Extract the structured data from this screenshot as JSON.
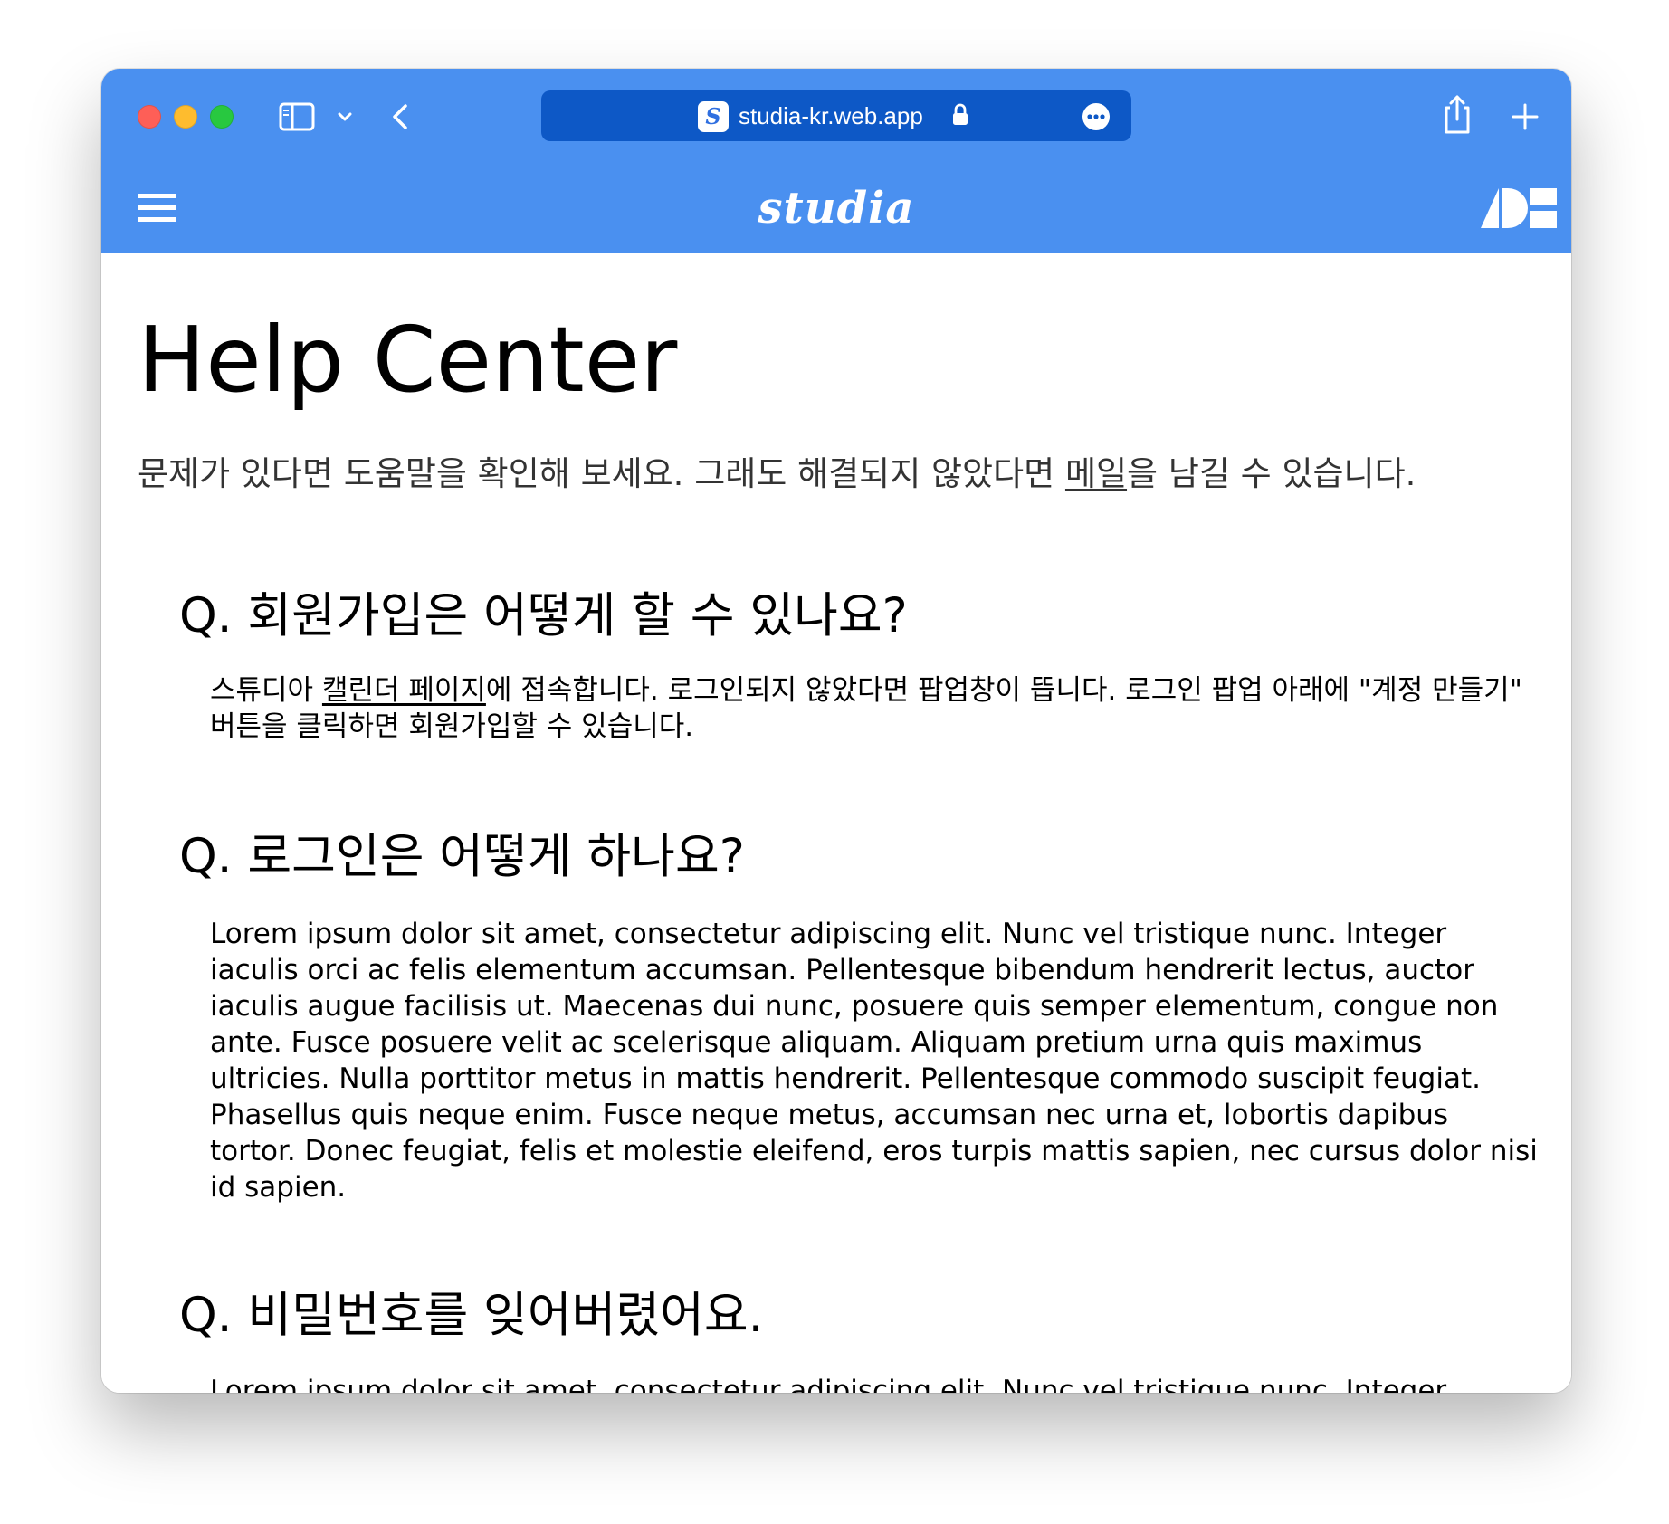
{
  "browser": {
    "url": "studia-kr.web.app",
    "favicon_letter": "S",
    "icons": [
      "sidebar-icon",
      "chevron-down-icon",
      "back-icon",
      "lock-icon",
      "more-icon",
      "share-icon",
      "plus-icon"
    ]
  },
  "appbar": {
    "brand": "studia",
    "icons": [
      "menu-icon",
      "brand-logo-icon"
    ]
  },
  "page": {
    "title": "Help Center",
    "intro": {
      "before_link": "문제가 있다면 도움말을 확인해 보세요. 그래도 해결되지 않았다면 ",
      "link": "메일",
      "after_link": "을 남길 수 있습니다."
    }
  },
  "faq": [
    {
      "question": "Q. 회원가입은 어떻게 할 수 있나요?",
      "answer_before_link": "스튜디아 ",
      "answer_link": "캘린더 페이지",
      "answer_after_link": "에 접속합니다. 로그인되지 않았다면 팝업창이 뜹니다. 로그인 팝업 아래에 \"계정 만들기\" 버튼을 클릭하면 회원가입할 수 있습니다."
    },
    {
      "question": "Q. 로그인은 어떻게 하나요?",
      "answer": "Lorem ipsum dolor sit amet, consectetur adipiscing elit. Nunc vel tristique nunc. Integer iaculis orci ac felis elementum accumsan. Pellentesque bibendum hendrerit lectus, auctor iaculis augue facilisis ut. Maecenas dui nunc, posuere quis semper elementum, congue non ante. Fusce posuere velit ac scelerisque aliquam. Aliquam pretium urna quis maximus ultricies. Nulla porttitor metus in mattis hendrerit. Pellentesque commodo suscipit feugiat. Phasellus quis neque enim. Fusce neque metus, accumsan nec urna et, lobortis dapibus tortor. Donec feugiat, felis et molestie eleifend, eros turpis mattis sapien, nec cursus dolor nisi id sapien."
    },
    {
      "question": "Q. 비밀번호를 잊어버렸어요.",
      "answer": "Lorem ipsum dolor sit amet, consectetur adipiscing elit. Nunc vel tristique nunc. Integer"
    }
  ],
  "colors": {
    "titlebar": "#4a90f0",
    "urlbar": "#0d58c6",
    "appbar": "#4a90f0",
    "text": "#000000",
    "intro_text": "#333333"
  }
}
